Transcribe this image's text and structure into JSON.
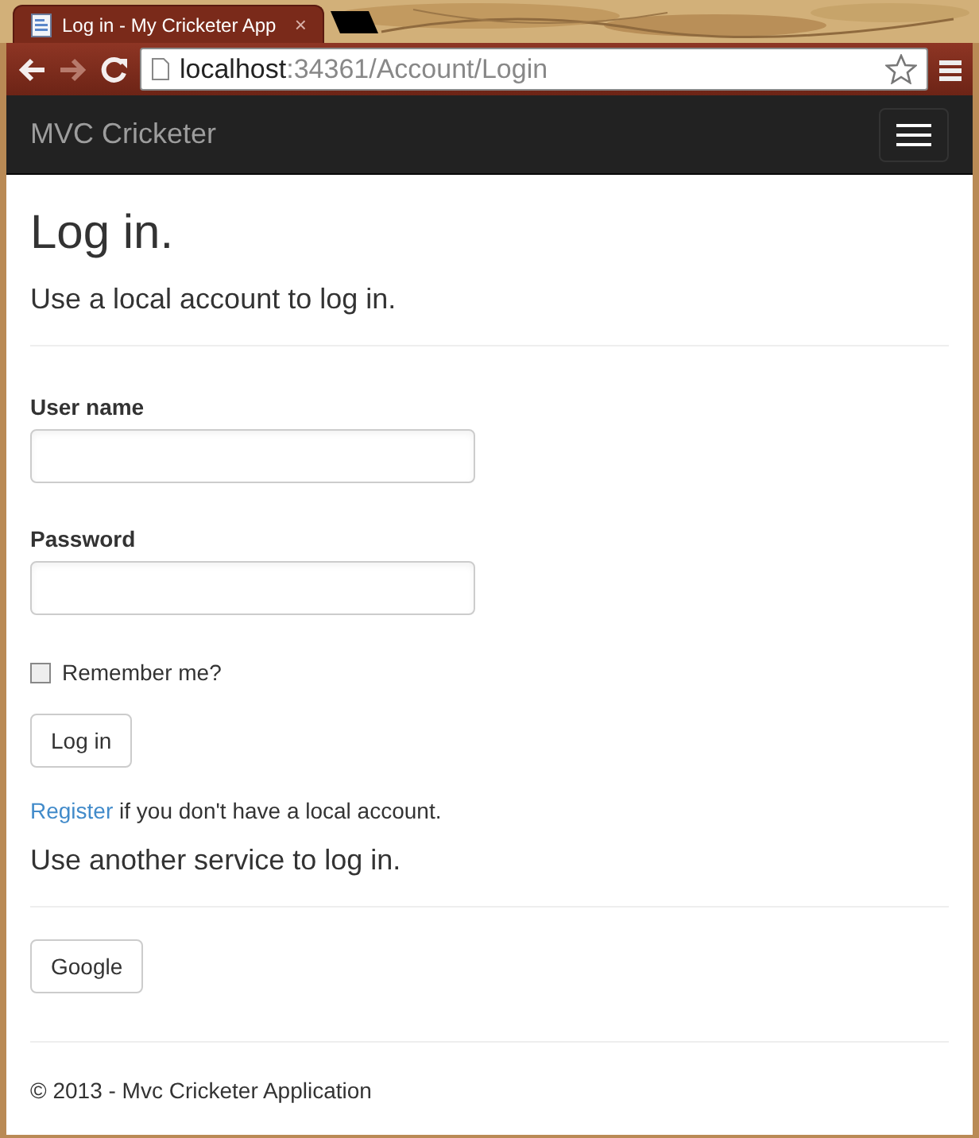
{
  "browser": {
    "tab": {
      "title": "Log in - My Cricketer App",
      "close": "×"
    },
    "address": {
      "host": "localhost",
      "rest": ":34361/Account/Login"
    },
    "forward_disabled": true
  },
  "navbar": {
    "brand": "MVC Cricketer"
  },
  "page": {
    "heading": "Log in.",
    "subheading": "Use a local account to log in.",
    "fields": [
      {
        "label": "User name"
      },
      {
        "label": "Password"
      }
    ],
    "remember": {
      "label": "Remember me?",
      "checked": false
    },
    "submit": "Log in",
    "register": {
      "link": "Register",
      "text": " if you don't have a local account."
    },
    "external_heading": "Use another service to log in.",
    "providers": [
      "Google"
    ],
    "footer": "© 2013 - Mvc Cricketer Application"
  }
}
